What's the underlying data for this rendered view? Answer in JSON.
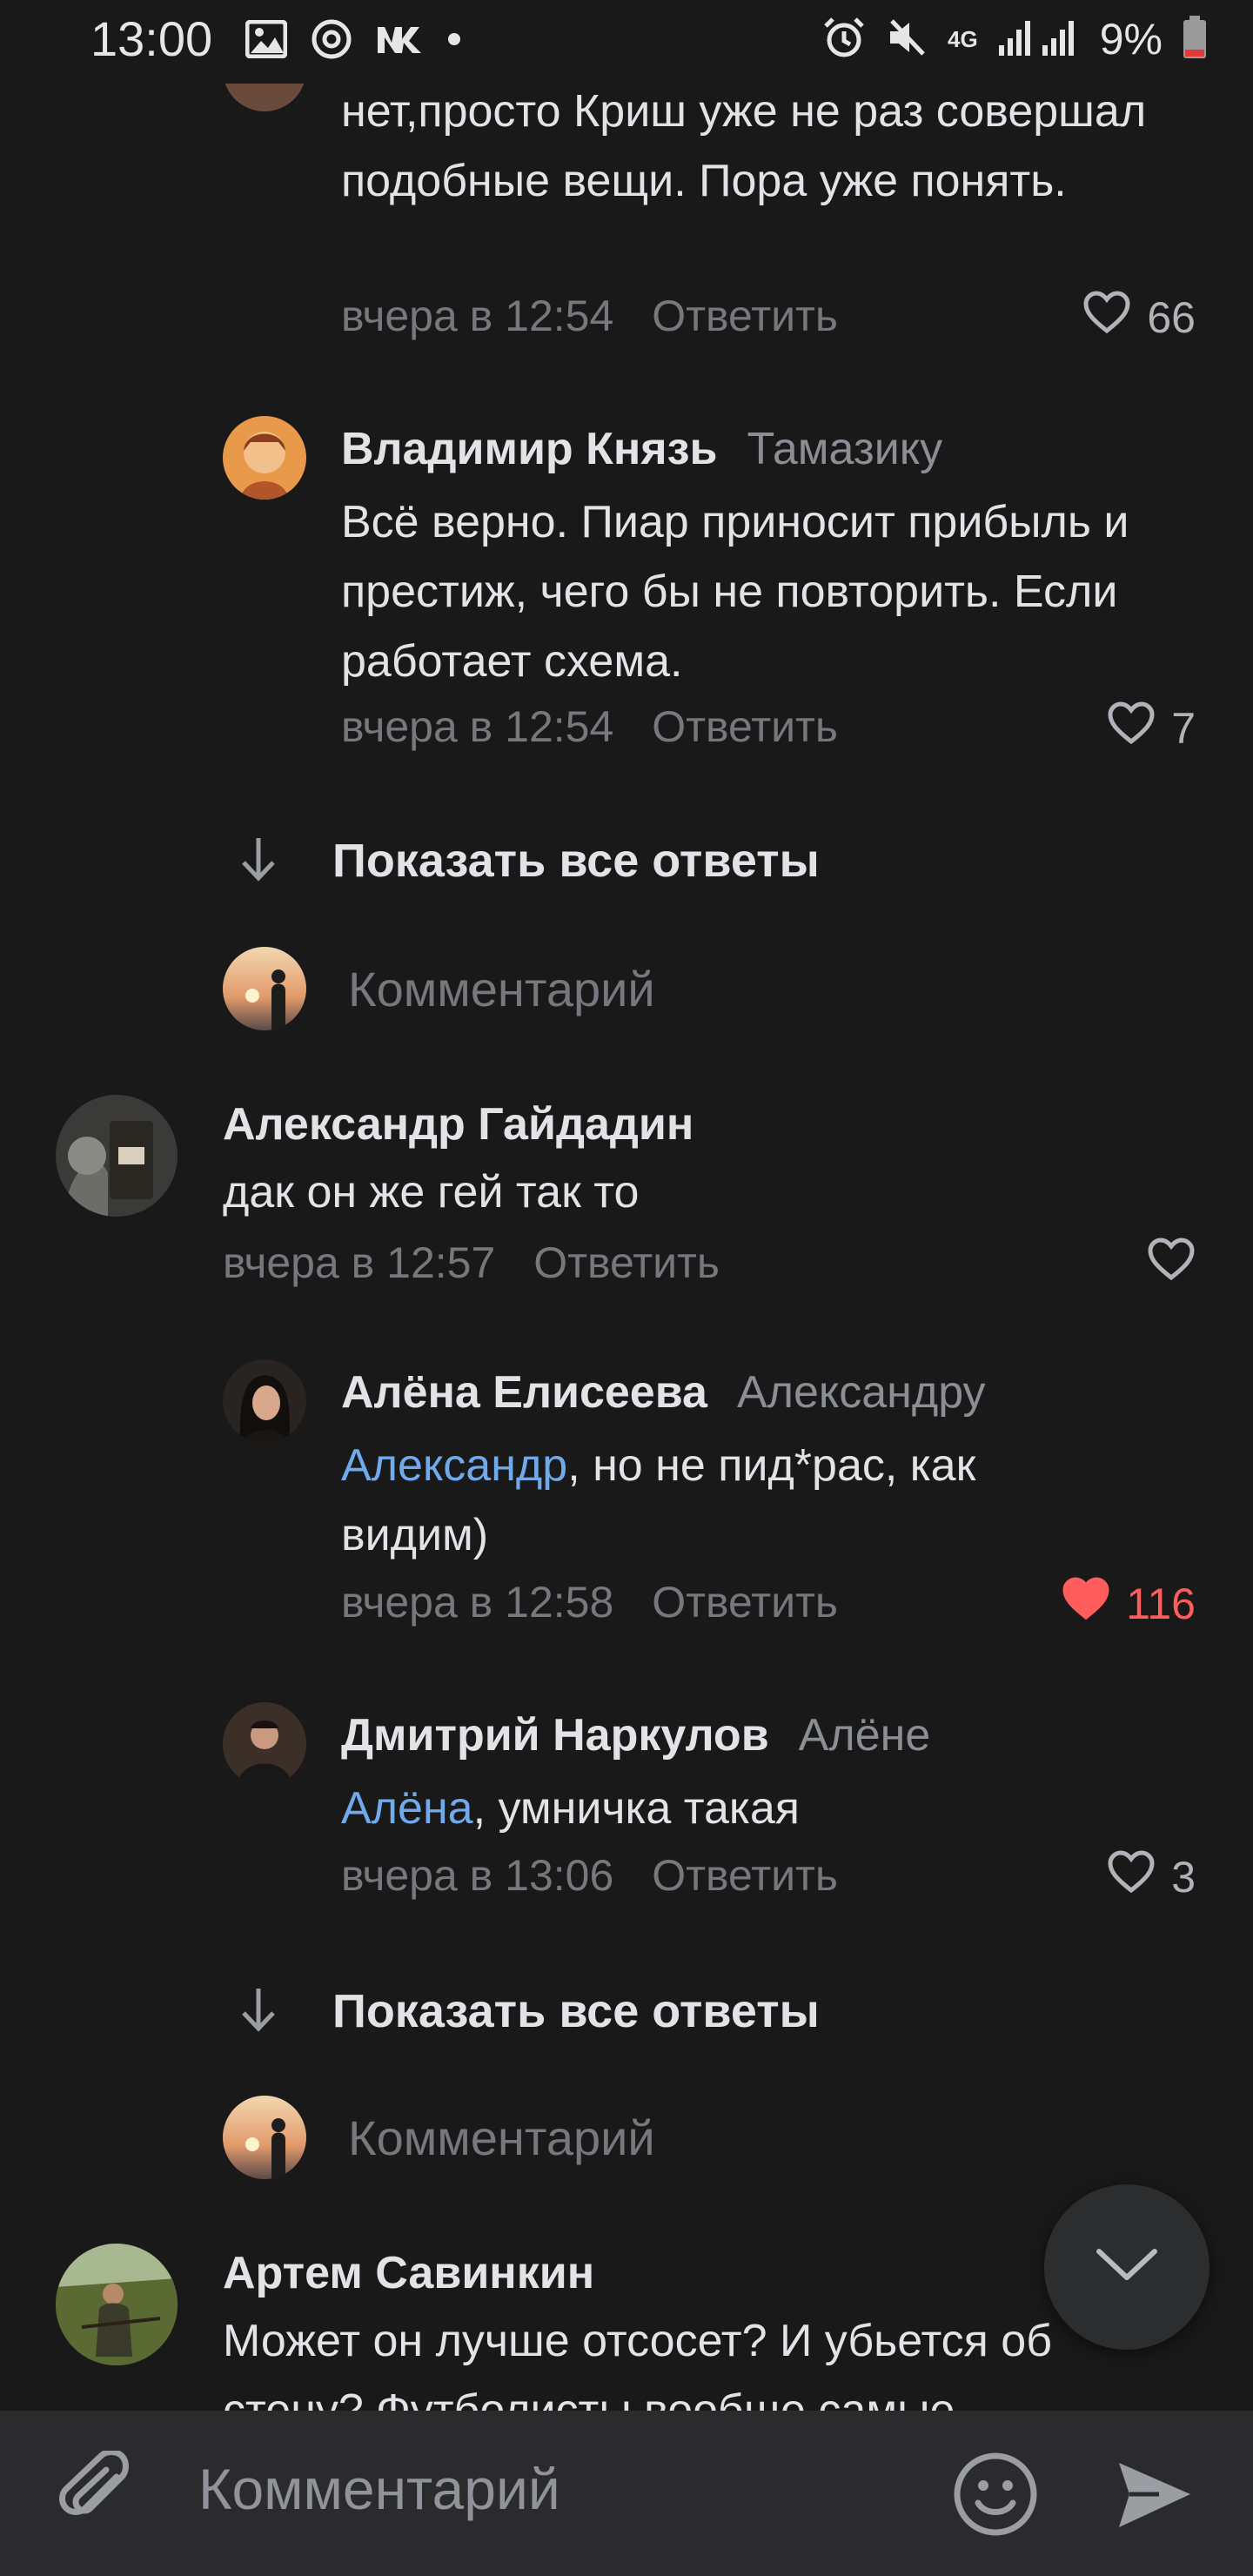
{
  "status_bar": {
    "time": "13:00",
    "network": "4G",
    "battery": "9%",
    "icons": [
      "image-icon",
      "sync-icon",
      "vk-icon",
      "dot-icon",
      "alarm-icon",
      "mute-icon",
      "signal-icon",
      "battery-icon"
    ]
  },
  "comments": [
    {
      "text": "нет,просто Криш уже не раз совершал подобные вещи. Пора уже понять.",
      "time": "вчера в 12:54",
      "reply_label": "Ответить",
      "likes": "66",
      "liked": false
    },
    {
      "author": "Владимир Князь",
      "reply_to": "Тамазику",
      "text": "Всё верно. Пиар приносит прибыль и престиж, чего бы не повторить. Если работает схема.",
      "time": "вчера в 12:54",
      "reply_label": "Ответить",
      "likes": "7",
      "liked": false
    },
    {
      "author": "Александр Гайдадин",
      "text": "дак он же гей так то",
      "time": "вчера в 12:57",
      "reply_label": "Ответить",
      "likes": "",
      "liked": false
    },
    {
      "author": "Алёна Елисеева",
      "reply_to": "Александру",
      "mention": "Александр",
      "text": ", но не пид*рас, как видим)",
      "time": "вчера в 12:58",
      "reply_label": "Ответить",
      "likes": "116",
      "liked": true
    },
    {
      "author": "Дмитрий Наркулов",
      "reply_to": "Алёне",
      "mention": "Алёна",
      "text": ", умничка такая",
      "time": "вчера в 13:06",
      "reply_label": "Ответить",
      "likes": "3",
      "liked": false
    },
    {
      "author": "Артем Савинкин",
      "text": "Может он лучше отсосет? И убьется об стену? Футболисты вообще самые"
    }
  ],
  "show_all_replies": "Показать все ответы",
  "comment_placeholder": "Комментарий",
  "composer": {
    "placeholder": "Комментарий",
    "icons": [
      "attach-icon",
      "emoji-icon",
      "send-icon"
    ]
  },
  "colors": {
    "background": "#19191a",
    "text": "#e1e3e6",
    "secondary": "#76787d",
    "mention": "#71aaeb",
    "liked": "#ff5c5c",
    "composer": "#2b2b2d"
  }
}
